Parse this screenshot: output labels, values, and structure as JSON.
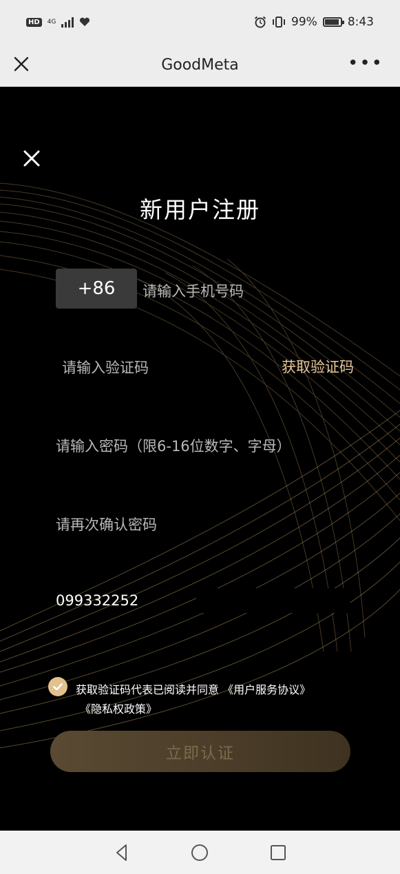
{
  "status_bar": {
    "left_icons": [
      "hd-badge",
      "4g-signal-icon",
      "heart-icon"
    ],
    "hd": "HD",
    "network": "4G",
    "battery_text": "99%",
    "time": "8:43"
  },
  "title_bar": {
    "title": "GoodMeta",
    "more": "•••"
  },
  "form": {
    "title": "新用户注册",
    "country_code": "+86",
    "phone_placeholder": "请输入手机号码",
    "code_placeholder": "请输入验证码",
    "get_code_label": "获取验证码",
    "password_placeholder": "请输入密码（限6-16位数字、字母）",
    "confirm_password_placeholder": "请再次确认密码",
    "invite_value": "099332252",
    "agreement_line1": "获取验证码代表已阅读并同意 《用户服务协议》",
    "agreement_line2": "《隐私权政策》",
    "agreement_checked": true,
    "submit_label": "立即认证"
  },
  "colors": {
    "accent": "#e6c79a",
    "check": "#e2c18e",
    "background": "#000000"
  }
}
